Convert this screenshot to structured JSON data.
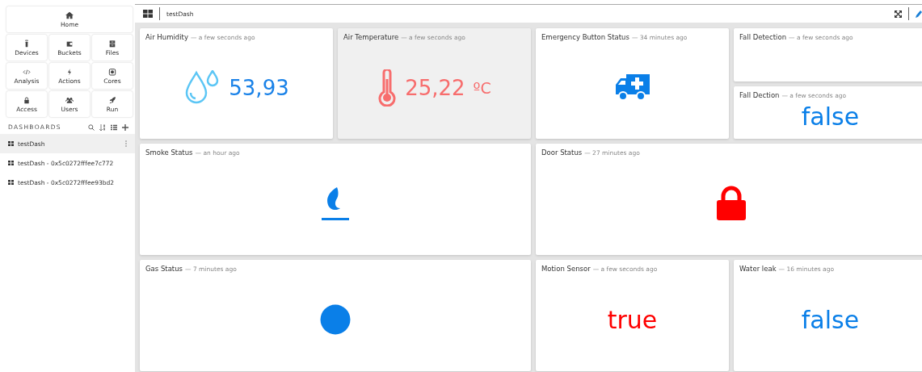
{
  "sidebar": {
    "home": {
      "label": "Home"
    },
    "nav": [
      {
        "label": "Devices"
      },
      {
        "label": "Buckets"
      },
      {
        "label": "Files"
      },
      {
        "label": "Analysis"
      },
      {
        "label": "Actions"
      },
      {
        "label": "Cores"
      },
      {
        "label": "Access"
      },
      {
        "label": "Users"
      },
      {
        "label": "Run"
      }
    ],
    "dashboards_heading": "DASHBOARDS",
    "dashboards": [
      {
        "name": "testDash",
        "selected": true
      },
      {
        "name": "testDash - 0x5c0272fffee7c772",
        "selected": false
      },
      {
        "name": "testDash - 0x5c0272fffee93bd2",
        "selected": false
      }
    ]
  },
  "toolbar": {
    "title": "testDash"
  },
  "widgets": [
    {
      "title": "Air Humidity",
      "time": "— a few seconds ago",
      "kind": "humidity",
      "value": "53,93",
      "color": "#1a82e8",
      "hovered": false
    },
    {
      "title": "Air Temperature",
      "time": "— a few seconds ago",
      "kind": "temperature",
      "value": "25,22",
      "unit": "ºC",
      "color": "#f76d6d",
      "hovered": true
    },
    {
      "title": "Emergency Button Status",
      "time": "— 34 minutes ago",
      "kind": "ambulance",
      "color": "#0a7fe8",
      "hovered": false
    },
    {
      "title": "Fall Detection",
      "time": "— a few seconds ago",
      "kind": "empty",
      "hovered": false
    },
    {
      "title": "Fall Dection",
      "time": "— a few seconds ago",
      "kind": "text",
      "value": "false",
      "color": "#0a7fe8",
      "hovered": false
    },
    {
      "title": "Smoke Status",
      "time": "— an hour ago",
      "kind": "flame",
      "color": "#0a7fe8",
      "hovered": false
    },
    {
      "title": "Door Status",
      "time": "— 27 minutes ago",
      "kind": "lock",
      "color": "#ff0000",
      "hovered": false
    },
    {
      "title": "Gas Status",
      "time": "— 7 minutes ago",
      "kind": "dot",
      "color": "#0a7fe8",
      "hovered": false
    },
    {
      "title": "Motion Sensor",
      "time": "— a few seconds ago",
      "kind": "text",
      "value": "true",
      "color": "#ff0000",
      "hovered": false
    },
    {
      "title": "Water leak",
      "time": "— 16 minutes ago",
      "kind": "text",
      "value": "false",
      "color": "#0a7fe8",
      "hovered": false
    }
  ]
}
